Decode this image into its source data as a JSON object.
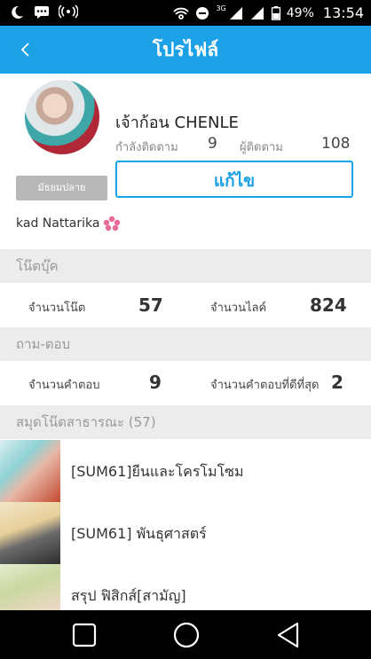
{
  "status_bar": {
    "battery": "49%",
    "time": "13:54",
    "network": "3G"
  },
  "app_bar": {
    "title": "โปรไฟล์",
    "background_color": "#1da1e6"
  },
  "profile": {
    "username": "เจ้าก้อน CHENLE",
    "following_label": "กำลังติดตาม",
    "following_count": "9",
    "followers_label": "ผู้ติดตาม",
    "followers_count": "108",
    "level_badge": "มัธยมปลาย",
    "edit_button": "แก้ไข",
    "bio": "kad Nattarika"
  },
  "notebook_section": {
    "title": "โน๊ตบุ๊ค",
    "notes_label": "จำนวนโน๊ต",
    "notes_count": "57",
    "likes_label": "จำนวนไลค์",
    "likes_count": "824"
  },
  "qa_section": {
    "title": "ถาม-ตอบ",
    "answers_label": "จำนวนคำตอบ",
    "answers_count": "9",
    "best_answers_label": "จำนวนคำตอบที่ดีที่สุด",
    "best_answers_count": "2"
  },
  "public_notebooks": {
    "title": "สมุดโน๊ตสาธารณะ (57)",
    "items": [
      {
        "label": "[SUM61]ยีนและโครโมโซม"
      },
      {
        "label": "[SUM61] พันธุศาสตร์"
      },
      {
        "label": "สรุป ฟิสิกส์[สามัญ]"
      }
    ]
  },
  "nav_bar": {
    "icons": [
      "recent-apps-icon",
      "home-icon",
      "back-icon"
    ]
  }
}
